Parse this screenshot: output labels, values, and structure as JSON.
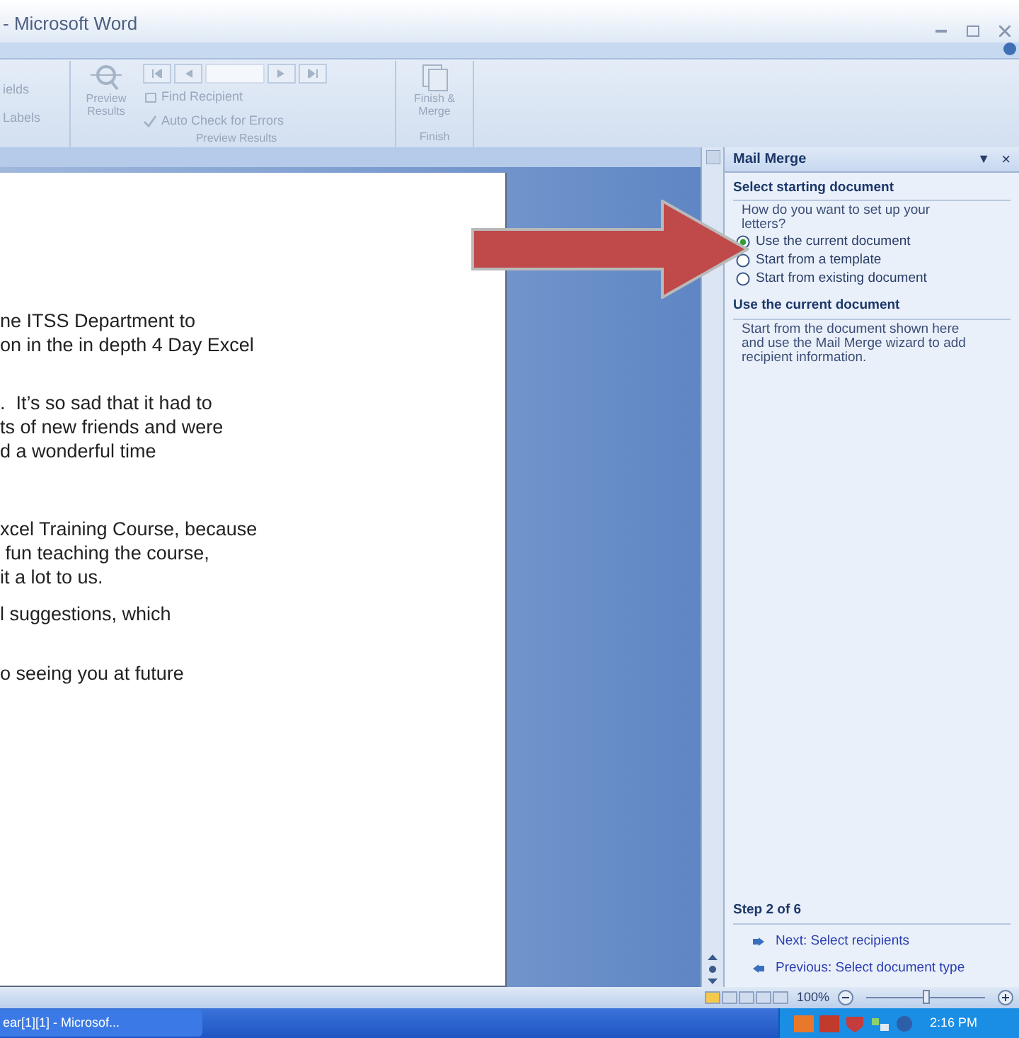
{
  "window": {
    "title": "- Microsoft Word"
  },
  "ribbon": {
    "partial_group": {
      "items": [
        "ields",
        "Labels"
      ]
    },
    "groups": [
      {
        "label": "Preview Results",
        "preview_button": "Preview Results",
        "find_recipient": "Find Recipient",
        "auto_check": "Auto Check for Errors"
      },
      {
        "label": "Finish",
        "finish_button": "Finish & Merge"
      }
    ]
  },
  "document": {
    "paragraphs": [
      [
        "ne ITSS Department to",
        "on in the in depth 4 Day Excel"
      ],
      [
        ".  It’s so sad that it had to",
        "ts of new friends and were",
        "d a wonderful time"
      ],
      [
        "xcel Training Course, because",
        " fun teaching the course,",
        "it a lot to us."
      ],
      [
        "l suggestions, which"
      ],
      [
        "o seeing you at future"
      ]
    ]
  },
  "task_pane": {
    "title": "Mail Merge",
    "dropdown": "▼",
    "close": "×",
    "section_1": {
      "heading": "Select starting document",
      "question": "How do you want to set up your letters?",
      "options": [
        {
          "label": "Use the current document",
          "selected": true
        },
        {
          "label": "Start from a template",
          "selected": false
        },
        {
          "label": "Start from existing document",
          "selected": false
        }
      ]
    },
    "section_2": {
      "heading": "Use the current document",
      "description": "Start from the document shown here and use the Mail Merge wizard to add recipient information."
    },
    "step": "Step 2 of 6",
    "links": [
      "Next: Select recipients",
      "Previous: Select document type"
    ]
  },
  "status_bar": {
    "zoom": "100%",
    "level": 0.5
  },
  "taskbar": {
    "task": "ear[1][1] - Microsof...",
    "clock": "2:16 PM"
  }
}
